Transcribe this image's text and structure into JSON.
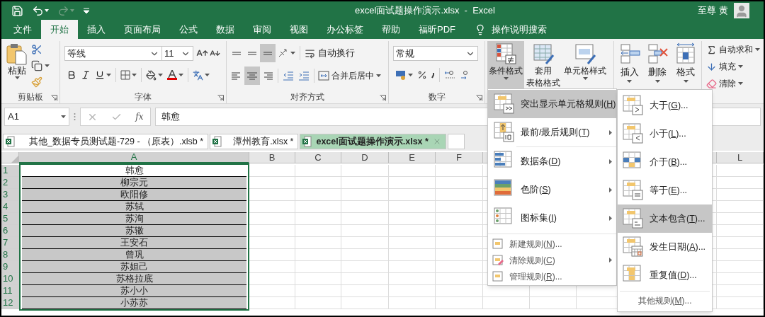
{
  "title_bar": {
    "title": "excel面试题操作演示.xlsx  -  Excel",
    "user": "至尊 黄"
  },
  "quick_access": [
    {
      "kind": "save",
      "disabled": false
    },
    {
      "kind": "undo",
      "disabled": false
    },
    {
      "kind": "redo",
      "disabled": true
    },
    {
      "kind": "customize",
      "disabled": false
    }
  ],
  "ribbon_tabs": [
    {
      "label": "文件",
      "selected": false
    },
    {
      "label": "开始",
      "selected": true
    },
    {
      "label": "插入",
      "selected": false
    },
    {
      "label": "页面布局",
      "selected": false
    },
    {
      "label": "公式",
      "selected": false
    },
    {
      "label": "数据",
      "selected": false
    },
    {
      "label": "审阅",
      "selected": false
    },
    {
      "label": "视图",
      "selected": false
    },
    {
      "label": "办公标签",
      "selected": false
    },
    {
      "label": "帮助",
      "selected": false
    },
    {
      "label": "福昕PDF",
      "selected": false
    }
  ],
  "search_hint": "操作说明搜索",
  "ribbon": {
    "clipboard": {
      "paste": "粘贴",
      "label": "剪贴板"
    },
    "font": {
      "name": "等线",
      "size": "11",
      "label": "字体"
    },
    "alignment": {
      "vertical": [
        {
          "selected": false
        },
        {
          "selected": false
        },
        {
          "selected": true
        }
      ],
      "horizontal": [
        {
          "selected": false
        },
        {
          "selected": true
        },
        {
          "selected": false
        }
      ],
      "wrap": "自动换行",
      "merge": "合并后居中",
      "label": "对齐方式"
    },
    "number": {
      "format": "常规",
      "label": "数字"
    },
    "styles": [
      {
        "lines": [
          "条件格式"
        ],
        "selected": true
      },
      {
        "lines": [
          "套用",
          "表格格式"
        ],
        "selected": false
      },
      {
        "lines": [
          "单元格样式"
        ],
        "selected": false
      }
    ],
    "cells": [
      {
        "label": "插入"
      },
      {
        "label": "删除"
      },
      {
        "label": "格式"
      }
    ],
    "editing": [
      {
        "label": "自动求和"
      },
      {
        "label": "填充"
      },
      {
        "label": "清除"
      }
    ]
  },
  "formula_bar": {
    "name_box": "A1",
    "function_label": "fx",
    "value": "韩愈"
  },
  "workbook_tabs": [
    {
      "label": "其他_数据专员测试题-729 - （原表）.xlsb *",
      "selected": false
    },
    {
      "label": "潭州教育.xlsx *",
      "selected": false
    },
    {
      "label": "excel面试题操作演示.xlsx *",
      "selected": true
    }
  ],
  "sheet": {
    "columns": [
      {
        "label": "A",
        "selected": true
      },
      {
        "label": "B",
        "selected": false
      },
      {
        "label": "C",
        "selected": false
      },
      {
        "label": "D",
        "selected": false
      },
      {
        "label": "E",
        "selected": false
      },
      {
        "label": "F",
        "selected": false
      },
      {
        "label": "L",
        "selected": false
      }
    ],
    "rows": [
      {
        "number": "1",
        "value": "韩愈",
        "highlighted": false
      },
      {
        "number": "2",
        "value": "柳宗元",
        "highlighted": true
      },
      {
        "number": "3",
        "value": "欧阳修",
        "highlighted": true
      },
      {
        "number": "4",
        "value": "苏轼",
        "highlighted": true
      },
      {
        "number": "5",
        "value": "苏洵",
        "highlighted": true
      },
      {
        "number": "6",
        "value": "苏辙",
        "highlighted": true
      },
      {
        "number": "7",
        "value": "王安石",
        "highlighted": true
      },
      {
        "number": "8",
        "value": "曾巩",
        "highlighted": true
      },
      {
        "number": "9",
        "value": "苏妲己",
        "highlighted": true
      },
      {
        "number": "10",
        "value": "苏格拉底",
        "highlighted": true
      },
      {
        "number": "11",
        "value": "苏小小",
        "highlighted": true
      },
      {
        "number": "12",
        "value": "小苏苏",
        "highlighted": true
      }
    ]
  },
  "cf_menu": {
    "items": [
      {
        "kind": "large",
        "label": "突出显示单元格规则(H)",
        "selected": true,
        "submenu": true
      },
      {
        "kind": "large",
        "label": "最前/最后规则(T)",
        "selected": false,
        "submenu": true
      },
      {
        "kind": "large",
        "label": "数据条(D)",
        "selected": false,
        "submenu": true
      },
      {
        "kind": "large",
        "label": "色阶(S)",
        "selected": false,
        "submenu": true
      },
      {
        "kind": "large",
        "label": "图标集(I)",
        "selected": false,
        "submenu": true
      },
      {
        "kind": "small",
        "label": "新建规则(N)...",
        "selected": false,
        "submenu": false
      },
      {
        "kind": "small",
        "label": "清除规则(C)",
        "selected": false,
        "submenu": true
      },
      {
        "kind": "small",
        "label": "管理规则(R)...",
        "selected": false,
        "submenu": false
      }
    ]
  },
  "cf_submenu": {
    "items": [
      {
        "label": "大于(G)...",
        "selected": false
      },
      {
        "label": "小于(L)...",
        "selected": false
      },
      {
        "label": "介于(B)...",
        "selected": false
      },
      {
        "label": "等于(E)...",
        "selected": false
      },
      {
        "label": "文本包含(T)...",
        "selected": true
      },
      {
        "label": "发生日期(A)...",
        "selected": false
      },
      {
        "label": "重复值(D)...",
        "selected": false
      }
    ],
    "footer": "其他规则(M)..."
  }
}
